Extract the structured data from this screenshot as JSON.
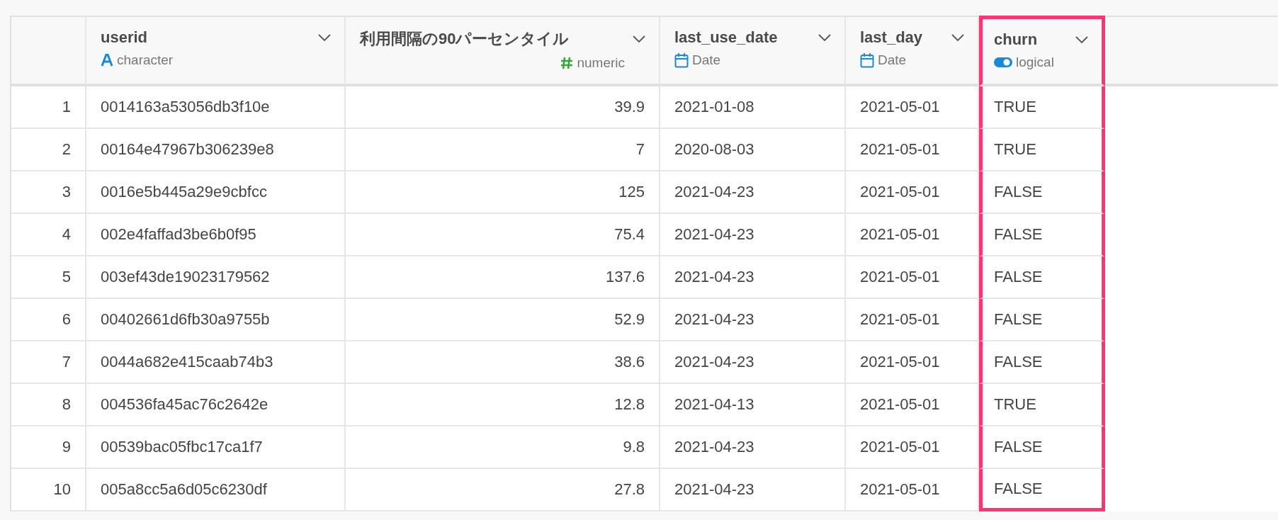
{
  "table": {
    "columns": [
      {
        "name": "userid",
        "type": "character",
        "kind": "character",
        "highlighted": false
      },
      {
        "name": "利用間隔の90パーセンタイル",
        "type": "numeric",
        "kind": "numeric",
        "highlighted": false
      },
      {
        "name": "last_use_date",
        "type": "Date",
        "kind": "date",
        "highlighted": false
      },
      {
        "name": "last_day",
        "type": "Date",
        "kind": "date",
        "highlighted": false
      },
      {
        "name": "churn",
        "type": "logical",
        "kind": "logical",
        "highlighted": true
      }
    ],
    "rows": [
      {
        "index": "1",
        "cells": [
          "0014163a53056db3f10e",
          "39.9",
          "2021-01-08",
          "2021-05-01",
          "TRUE"
        ]
      },
      {
        "index": "2",
        "cells": [
          "00164e47967b306239e8",
          "7",
          "2020-08-03",
          "2021-05-01",
          "TRUE"
        ]
      },
      {
        "index": "3",
        "cells": [
          "0016e5b445a29e9cbfcc",
          "125",
          "2021-04-23",
          "2021-05-01",
          "FALSE"
        ]
      },
      {
        "index": "4",
        "cells": [
          "002e4faffad3be6b0f95",
          "75.4",
          "2021-04-23",
          "2021-05-01",
          "FALSE"
        ]
      },
      {
        "index": "5",
        "cells": [
          "003ef43de19023179562",
          "137.6",
          "2021-04-23",
          "2021-05-01",
          "FALSE"
        ]
      },
      {
        "index": "6",
        "cells": [
          "00402661d6fb30a9755b",
          "52.9",
          "2021-04-23",
          "2021-05-01",
          "FALSE"
        ]
      },
      {
        "index": "7",
        "cells": [
          "0044a682e415caab74b3",
          "38.6",
          "2021-04-23",
          "2021-05-01",
          "FALSE"
        ]
      },
      {
        "index": "8",
        "cells": [
          "004536fa45ac76c2642e",
          "12.8",
          "2021-04-13",
          "2021-05-01",
          "TRUE"
        ]
      },
      {
        "index": "9",
        "cells": [
          "00539bac05fbc17ca1f7",
          "9.8",
          "2021-04-23",
          "2021-05-01",
          "FALSE"
        ]
      },
      {
        "index": "10",
        "cells": [
          "005a8cc5a6d05c6230df",
          "27.8",
          "2021-04-23",
          "2021-05-01",
          "FALSE"
        ]
      }
    ]
  }
}
